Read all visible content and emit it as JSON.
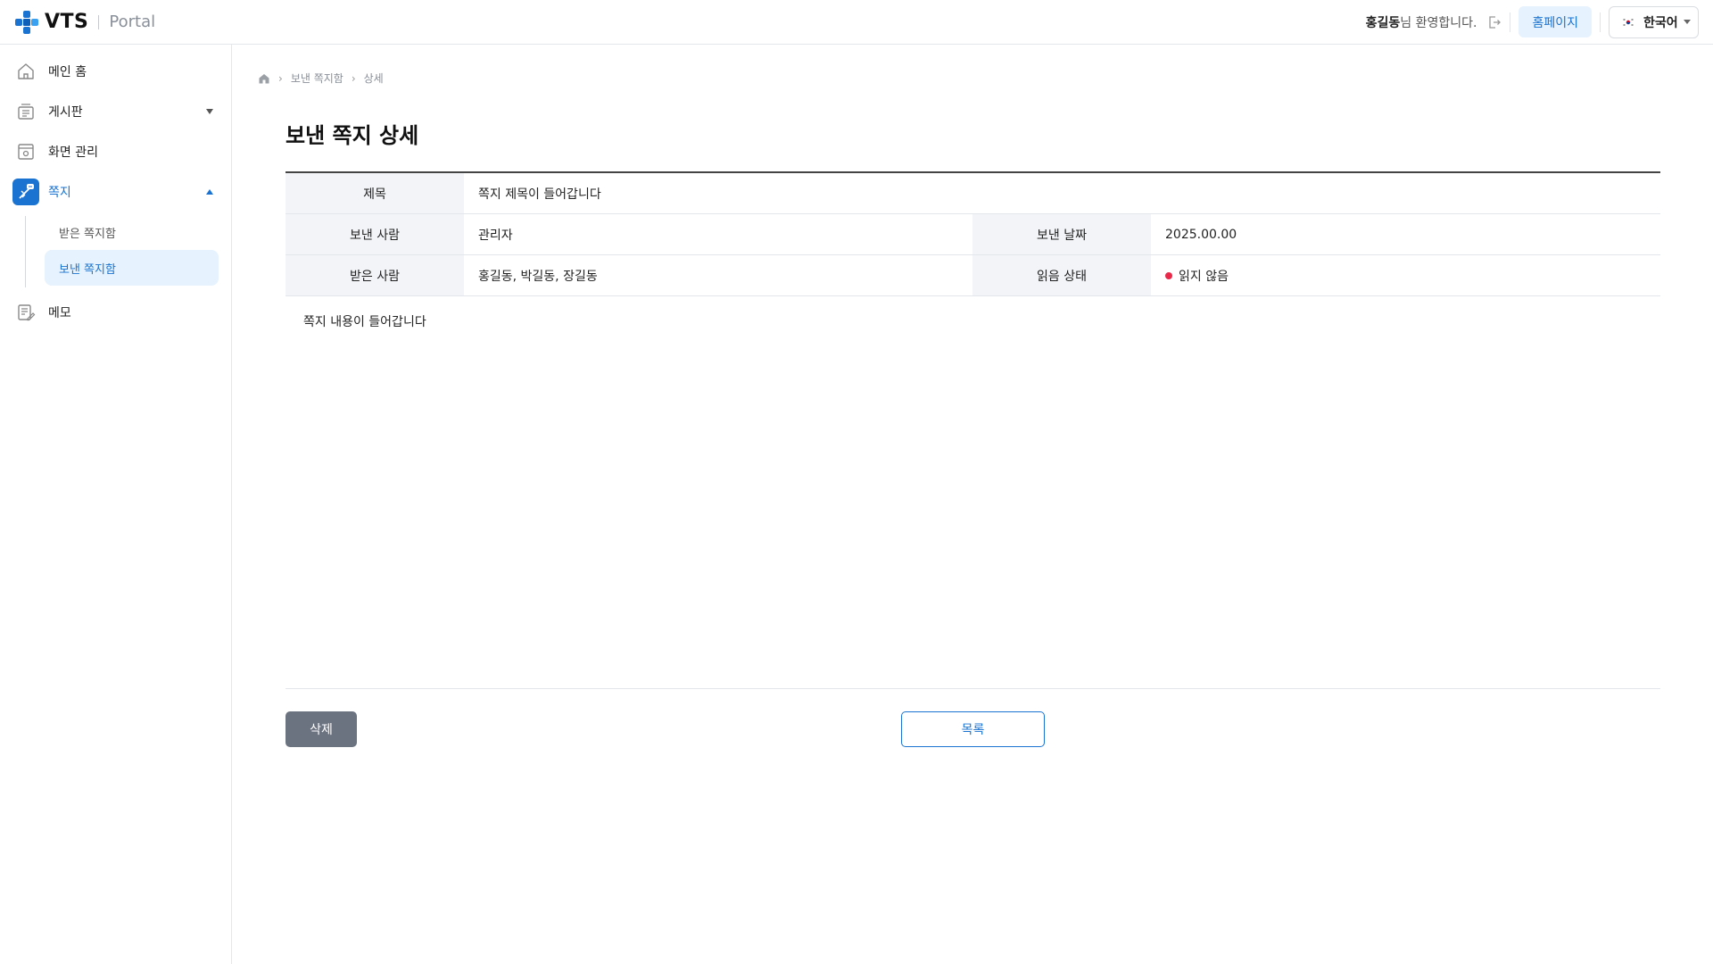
{
  "header": {
    "logo_text": "VTS",
    "logo_sub": "Portal",
    "user_name": "홍길동",
    "welcome_suffix": "님 환영합니다.",
    "home_button": "홈페이지",
    "language": "한국어"
  },
  "sidebar": {
    "items": [
      {
        "label": "메인 홈",
        "icon": "home-icon"
      },
      {
        "label": "게시판",
        "icon": "board-icon"
      },
      {
        "label": "화면 관리",
        "icon": "screen-manage-icon"
      },
      {
        "label": "쪽지",
        "icon": "message-icon"
      },
      {
        "label": "메모",
        "icon": "memo-icon"
      }
    ],
    "subitems": [
      {
        "label": "받은 쪽지함"
      },
      {
        "label": "보낸 쪽지함"
      }
    ]
  },
  "breadcrumb": {
    "items": [
      "보낸 쪽지함",
      "상세"
    ]
  },
  "page": {
    "title": "보낸 쪽지 상세"
  },
  "detail": {
    "title_label": "제목",
    "title_value": "쪽지 제목이 들어갑니다",
    "sender_label": "보낸 사람",
    "sender_value": "관리자",
    "date_label": "보낸 날짜",
    "date_value": "2025.00.00",
    "recipient_label": "받은 사람",
    "recipient_value": "홍길동, 박길동, 장길동",
    "read_label": "읽음 상태",
    "read_value": "읽지 않음",
    "read_color": "#e8294a",
    "content": "쪽지 내용이 들어갑니다"
  },
  "actions": {
    "delete_label": "삭제",
    "list_label": "목록"
  },
  "colors": {
    "accent": "#1a73d1",
    "accent_light": "#e6f2fd"
  }
}
